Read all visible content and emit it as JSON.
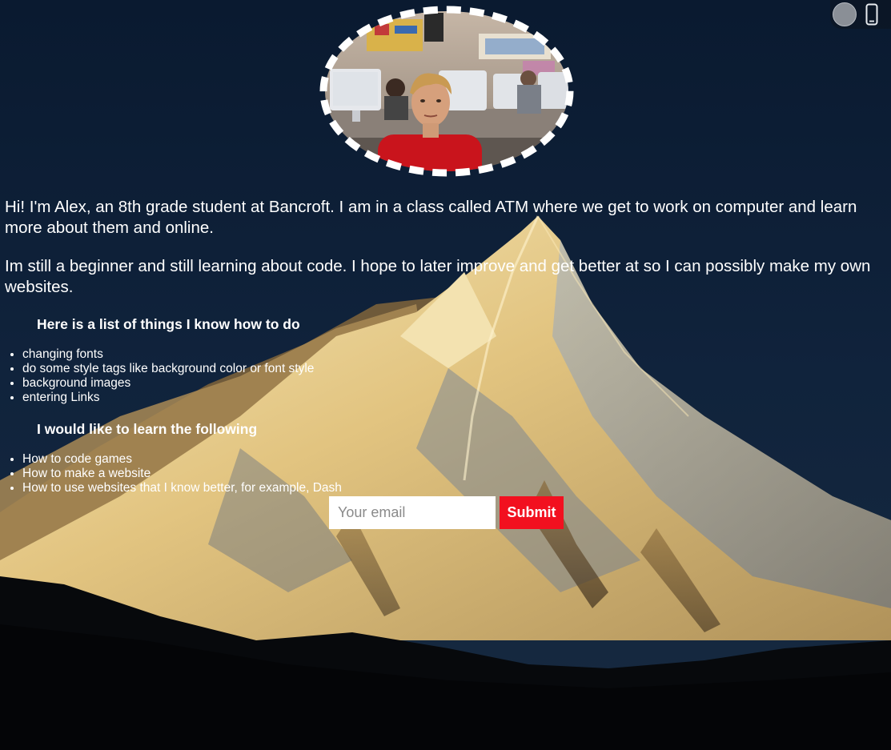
{
  "intro": {
    "paragraph_1": "Hi! I'm Alex, an 8th grade student at Bancroft. I am in a class called ATM where we get to work on computer and learn more about them and online.",
    "paragraph_2": "Im still a beginner and still learning about code. I hope to later improve and get better at so I can possibly make my own websites."
  },
  "known_section": {
    "heading": "Here is a list of things I know how to do",
    "items": [
      "changing fonts",
      "do some style tags like background color or font style",
      "background images",
      "entering Links"
    ]
  },
  "learn_section": {
    "heading": "I would like to learn the following",
    "items": [
      "How to code games",
      "How to make a website",
      "How to use websites that I know better, for example, Dash"
    ]
  },
  "signup_form": {
    "email_placeholder": "Your email",
    "submit_label": "Submit"
  },
  "view_toggle": {
    "icon": "phone-icon"
  },
  "colors": {
    "sky": "#0b1a2e",
    "submit_button": "#f2101f",
    "text": "#ffffff"
  }
}
